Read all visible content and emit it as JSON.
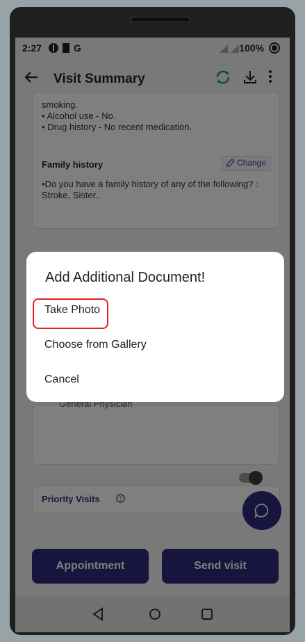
{
  "status_bar": {
    "time": "2:27",
    "left_icons": [
      "vpn-icon",
      "sim-icon",
      "google-icon"
    ],
    "g_label": "G",
    "battery": "100%"
  },
  "app_bar": {
    "title": "Visit Summary"
  },
  "summary": {
    "habits_lines": [
      "smoking.",
      "• Alcohol use - No.",
      "• Drug history - No recent medication."
    ],
    "family_history": {
      "title": "Family history",
      "change_label": "Change",
      "text": "•Do you have a family history of any of the following? : Stroke, Sister.."
    },
    "partial_text": "General Physician",
    "priority": {
      "label": "Priority Visits",
      "enabled": false
    }
  },
  "dialog": {
    "title": "Add Additional Document!",
    "options": [
      "Take Photo",
      "Choose from Gallery",
      "Cancel"
    ]
  },
  "bottom_buttons": {
    "appointment": "Appointment",
    "send_visit": "Send visit"
  },
  "colors": {
    "primary": "#2e2b7a",
    "sync_green": "#1b9e4b",
    "highlight": "#e0241c"
  }
}
